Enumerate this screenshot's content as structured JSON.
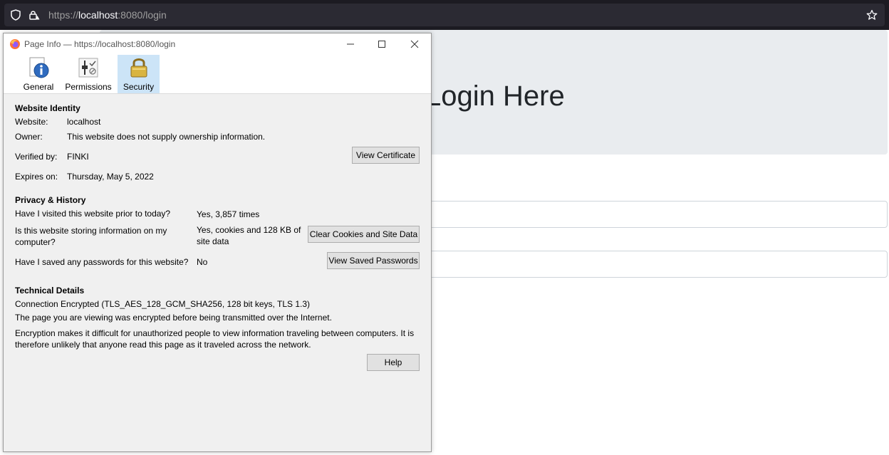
{
  "browser": {
    "url_prefix": "https://",
    "url_host": "localhost",
    "url_rest": ":8080/login"
  },
  "page": {
    "heading": "Login Here"
  },
  "dialog": {
    "title": "Page Info — https://localhost:8080/login",
    "tabs": [
      {
        "label": "General",
        "icon": "info-icon"
      },
      {
        "label": "Permissions",
        "icon": "permissions-icon"
      },
      {
        "label": "Security",
        "icon": "padlock-icon"
      }
    ],
    "identity": {
      "heading": "Website Identity",
      "website_label": "Website:",
      "website_value": "localhost",
      "owner_label": "Owner:",
      "owner_value": "This website does not supply ownership information.",
      "verified_label": "Verified by:",
      "verified_value": "FINKI",
      "view_cert_button": "View Certificate",
      "expires_label": "Expires on:",
      "expires_value": "Thursday, May 5, 2022"
    },
    "privacy": {
      "heading": "Privacy & History",
      "visited_q": "Have I visited this website prior to today?",
      "visited_a": "Yes, 3,857 times",
      "storing_q": "Is this website storing information on my computer?",
      "storing_a": "Yes, cookies and 128 KB of site data",
      "clear_button": "Clear Cookies and Site Data",
      "passwords_q": "Have I saved any passwords for this website?",
      "passwords_a": "No",
      "view_passwords_button": "View Saved Passwords"
    },
    "technical": {
      "heading": "Technical Details",
      "connection": "Connection Encrypted (TLS_AES_128_GCM_SHA256, 128 bit keys, TLS 1.3)",
      "encrypted_note": "The page you are viewing was encrypted before being transmitted over the Internet.",
      "explanation": "Encryption makes it difficult for unauthorized people to view information traveling between computers. It is therefore unlikely that anyone read this page as it traveled across the network.",
      "help_button": "Help"
    }
  }
}
